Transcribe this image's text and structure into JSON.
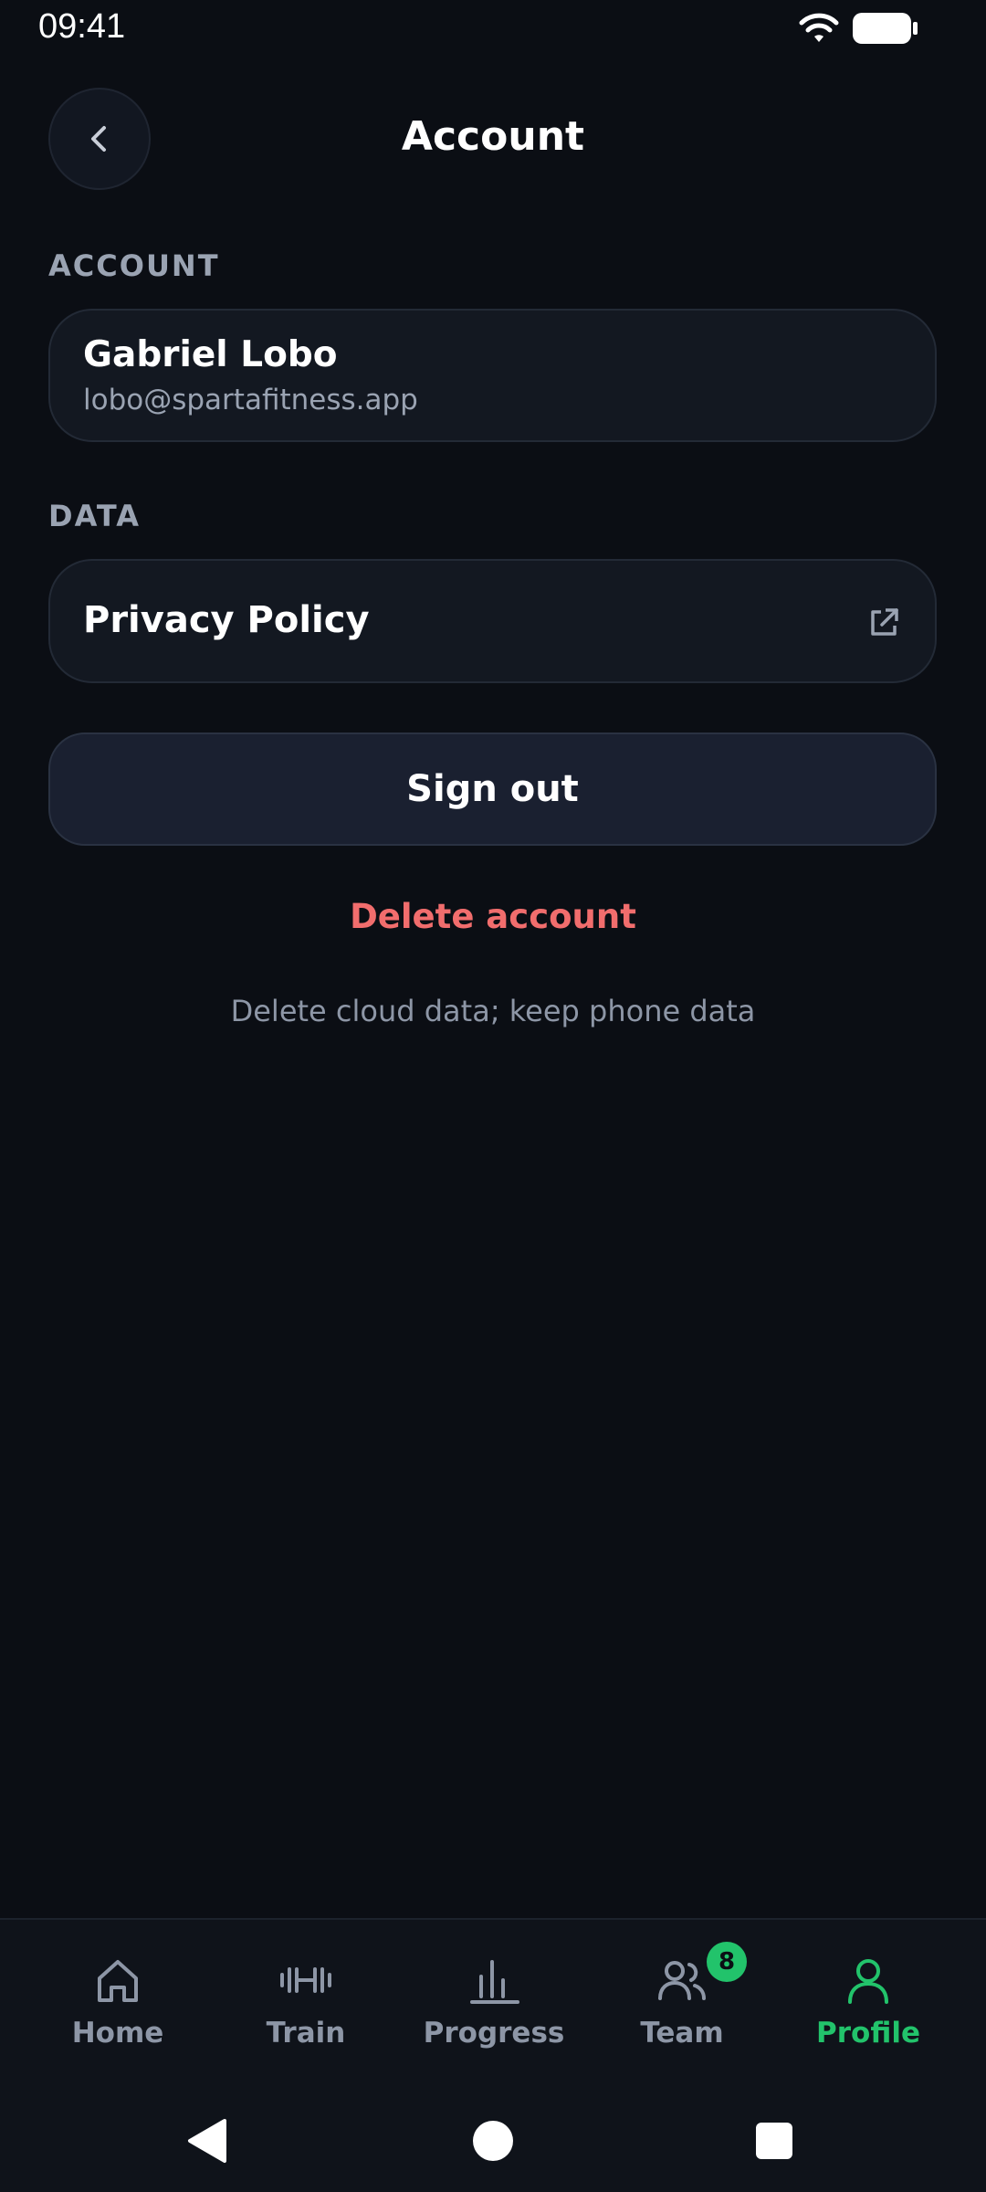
{
  "status_bar": {
    "time": "09:41"
  },
  "header": {
    "title": "Account",
    "back_icon": "chevron-left-icon"
  },
  "sections": {
    "account_label": "ACCOUNT",
    "data_label": "DATA"
  },
  "account": {
    "name": "Gabriel Lobo",
    "email": "lobo@spartafitness.app"
  },
  "privacy": {
    "label": "Privacy Policy",
    "icon": "external-link-icon"
  },
  "actions": {
    "sign_out": "Sign out",
    "delete_account": "Delete account",
    "delete_hint": "Delete cloud data; keep phone data"
  },
  "bottom_nav": {
    "items": [
      {
        "label": "Home",
        "icon": "home-icon"
      },
      {
        "label": "Train",
        "icon": "dumbbell-icon"
      },
      {
        "label": "Progress",
        "icon": "bar-chart-icon"
      },
      {
        "label": "Team",
        "icon": "team-icon",
        "badge": "8"
      },
      {
        "label": "Profile",
        "icon": "profile-icon",
        "active": true
      }
    ]
  },
  "colors": {
    "background": "#0b0e14",
    "card": "#131821",
    "accent_green": "#22c36b",
    "danger": "#f16d6d",
    "muted_text": "#9aa3b2"
  }
}
